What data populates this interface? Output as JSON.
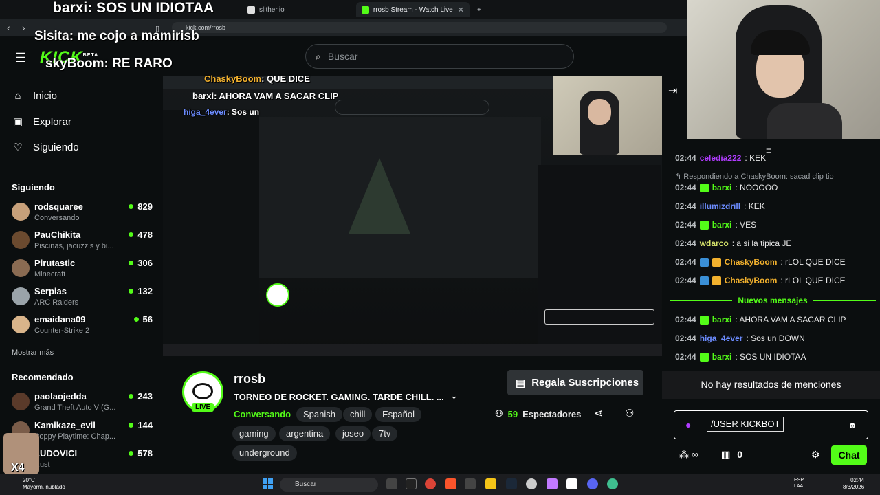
{
  "browser": {
    "tabs": [
      {
        "label": "",
        "active": false
      },
      {
        "label": "slither.io",
        "active": false
      },
      {
        "label": "rrosb Stream - Watch Live on Ki",
        "active": true
      }
    ],
    "new_tab": "+",
    "url": "kick.com/rrosb"
  },
  "overlays": {
    "line1_user": "barxi",
    "line1_text": ": SOS UN IDIOTAA",
    "line2_user": "Sisita",
    "line2_text": ": me cojo a mamirisb",
    "line3_user": "skyBoom",
    "line3_text": ": RE RARO",
    "cap_user1": "ChaskyBoom",
    "cap_text1": ": QUE DICE",
    "cap_user2": "barxi",
    "cap_text2": ": AHORA VAM A SACAR CLIP",
    "cap_user3": "higa_4ever",
    "cap_text3": ": Sos un",
    "badge": "X4"
  },
  "header": {
    "logo": "KICK",
    "logo_sup": "BETA",
    "search_placeholder": "Buscar"
  },
  "sidebar": {
    "nav": [
      {
        "label": "Inicio",
        "icon": "home-icon"
      },
      {
        "label": "Explorar",
        "icon": "explore-icon"
      },
      {
        "label": "Siguiendo",
        "icon": "heart-icon"
      }
    ],
    "following_title": "Siguiendo",
    "following": [
      {
        "name": "rodsquaree",
        "game": "Conversando",
        "viewers": "829"
      },
      {
        "name": "PauChikita",
        "game": "Piscinas, jacuzzis y bi...",
        "viewers": "478"
      },
      {
        "name": "Pirutastic",
        "game": "Minecraft",
        "viewers": "306"
      },
      {
        "name": "Serpias",
        "game": "ARC Raiders",
        "viewers": "132"
      },
      {
        "name": "emaidana09",
        "game": "Counter-Strike 2",
        "viewers": "56"
      }
    ],
    "show_more": "Mostrar más",
    "recommended_title": "Recomendado",
    "recommended": [
      {
        "name": "paolaojedda",
        "game": "Grand Theft Auto V (G...",
        "viewers": "243"
      },
      {
        "name": "Kamikaze_evil",
        "game": "Poppy Playtime: Chap...",
        "viewers": "144"
      },
      {
        "name": "LUDOVICI",
        "game": "Rust",
        "viewers": "578"
      }
    ]
  },
  "channel": {
    "name": "rrosb",
    "live": "LIVE",
    "title": "TORNEO DE ROCKET. GAMING. TARDE CHILL. ...",
    "category": "Conversando",
    "tags": [
      "Spanish",
      "chill",
      "Español",
      "gaming",
      "argentina",
      "joseo",
      "7tv",
      "underground"
    ],
    "gift_button": "Regala Suscripciones",
    "viewers_count": "59",
    "viewers_label": "Espectadores"
  },
  "chat": {
    "messages": [
      {
        "ts": "02:44",
        "user": "celedia222",
        "text": ": KEK",
        "color": "#b13cff"
      },
      {
        "ts": "02:44",
        "user": "barxi",
        "text": ": NOOOOO",
        "color": "#53fc18"
      },
      {
        "ts": "02:44",
        "user": "illumizdrill",
        "text": ": KEK",
        "color": "#6c8cff"
      },
      {
        "ts": "02:44",
        "user": "barxi",
        "text": ": VES",
        "color": "#53fc18"
      },
      {
        "ts": "02:44",
        "user": "wdarco",
        "text": ": a si la tipica JE",
        "color": "#d6e36b"
      },
      {
        "ts": "02:44",
        "user": "ChaskyBoom",
        "text": ": rLOL QUE DICE",
        "color": "#f2b12e"
      },
      {
        "ts": "02:44",
        "user": "ChaskyBoom",
        "text": ": rLOL QUE DICE",
        "color": "#f2b12e"
      },
      {
        "ts": "02:44",
        "user": "barxi",
        "text": ": AHORA VAM A SACAR CLIP",
        "color": "#53fc18"
      },
      {
        "ts": "02:44",
        "user": "higa_4ever",
        "text": ": Sos un DOWN",
        "color": "#6c8cff"
      },
      {
        "ts": "02:44",
        "user": "barxi",
        "text": ": SOS UN IDIOTAA",
        "color": "#53fc18"
      }
    ],
    "reply_to": "Respondiendo a ChaskyBoom: sacad clip tio",
    "new_messages": "Nuevos mensajes",
    "no_mentions": "No hay resultados de menciones",
    "input_value": "/USER KICKBOT",
    "points": "0",
    "send": "Chat"
  },
  "taskbar": {
    "weather_temp": "20°C",
    "weather_desc": "Mayorm. nublado",
    "search": "Buscar",
    "lang1": "ESP",
    "lang2": "LAA",
    "time": "02:44",
    "date": "8/3/2026"
  }
}
